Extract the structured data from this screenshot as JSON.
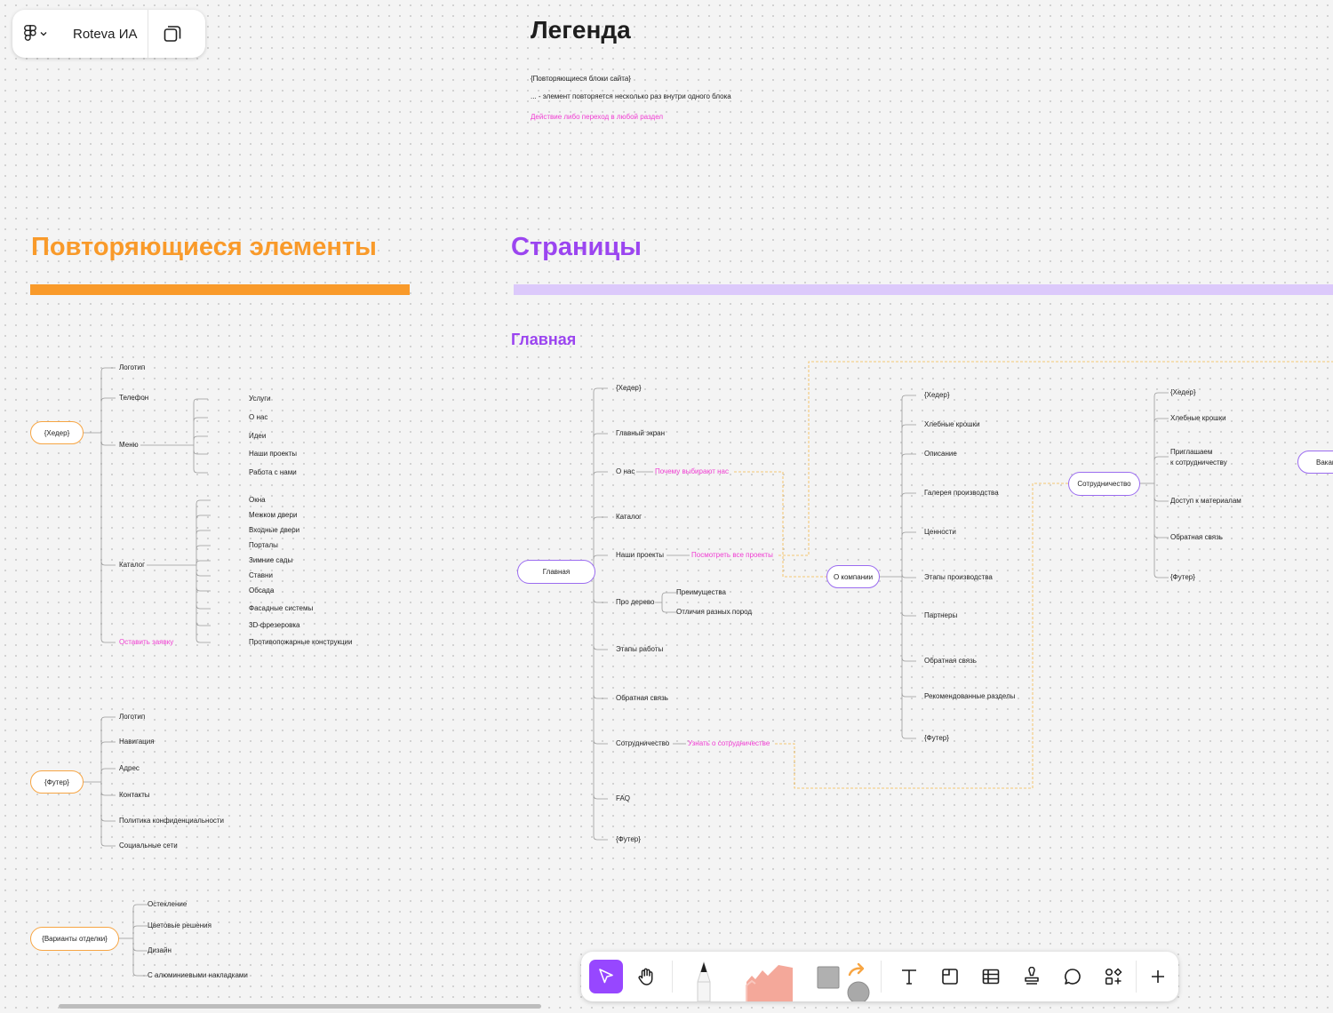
{
  "file": {
    "name": "Roteva ИА"
  },
  "legend": {
    "title": "Легенда",
    "lines": [
      "{Повторяющиеся блоки сайта}",
      "... - элемент повторяется несколько раз внутри одного блока",
      "Действие либо переход в любой раздел"
    ]
  },
  "sections": {
    "repeating": "Повторяющиеся элементы",
    "pages": "Страницы",
    "main": "Главная"
  },
  "colors": {
    "orange": "#f99a2a",
    "purple": "#9b45f0",
    "pink": "#f03bd2",
    "link_dashed": "#f5b94a",
    "accent": "#9747ff"
  },
  "header_tree": {
    "root": "{Хедер}",
    "items": [
      "Логотип",
      "Телефон",
      "Меню",
      "Каталог",
      "Оставить заявку"
    ],
    "menu": [
      "Услуги",
      "О нас",
      "Идеи",
      "Наши проекты",
      "Работа с нами"
    ],
    "catalog": [
      "Окна",
      "Межком двери",
      "Входные двери",
      "Порталы",
      "Зимние сады",
      "Ставни",
      "Обсада",
      "Фасадные системы",
      "3D-фрезеровка",
      "Противопожарные конструкции"
    ]
  },
  "footer_tree": {
    "root": "{Футер}",
    "items": [
      "Логотип",
      "Навигация",
      "Адрес",
      "Контакты",
      "Политика конфиденциальности",
      "Социальные сети"
    ]
  },
  "finish_tree": {
    "root": "{Варианты отделки}",
    "items": [
      "Остекление",
      "Цветовые решения",
      "Дизайн",
      "С алюминиевыми накладками"
    ]
  },
  "main_tree": {
    "root": "Главная",
    "items": [
      "{Хедер}",
      "Главный экран",
      "О нас",
      "Каталог",
      "Наши проекты",
      "Про дерево",
      "Этапы работы",
      "Обратная связь",
      "Сотрудничество",
      "FAQ",
      "{Футер}"
    ],
    "links": [
      "Почему выбирают нас",
      "Посмотреть все проекты",
      "Узнать о сотрудничестве"
    ],
    "wood": [
      "Преимущества",
      "Отличия разных пород"
    ]
  },
  "about_tree": {
    "root": "О компании",
    "items": [
      "{Хедер}",
      "Хлебные крошки",
      "Описание",
      "Галерея производства",
      "Ценности",
      "Этапы производства",
      "Партнеры",
      "Обратная связь",
      "Рекомендованные разделы",
      "{Футер}"
    ]
  },
  "coop_tree": {
    "root": "Сотрудничество",
    "items": [
      "{Хедер}",
      "Хлебные крошки",
      "Приглашаем\nк сотрудничеству",
      "Доступ к материалам",
      "Обратная связь",
      "{Футер}"
    ]
  },
  "vacancy_node": "Вакансии",
  "toolbar": {
    "tools": [
      "move-tool",
      "hand-tool",
      "marker-tool",
      "highlighter-tool",
      "shape-tool",
      "connector-tool",
      "text-tool",
      "section-tool",
      "table-tool",
      "stamp-tool",
      "comment-tool",
      "widgets-tool",
      "more-tool"
    ],
    "selected": "move-tool",
    "swatches": {
      "shape_square": "#b0b0b0",
      "shape_circle": "#a9a9a9",
      "arrow": "#f7a543",
      "highlighter": "#f4a89a"
    }
  }
}
